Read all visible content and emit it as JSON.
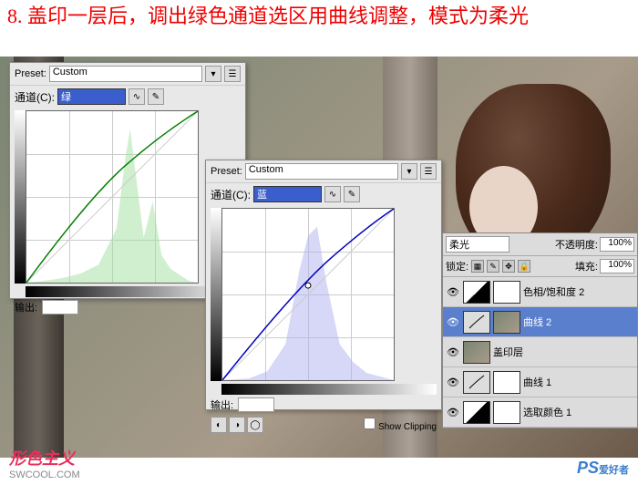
{
  "instruction": "8. 盖印一层后，调出绿色通道选区用曲线调整，模式为柔光",
  "curves1": {
    "preset_label": "Preset:",
    "preset_value": "Custom",
    "channel_label": "通道(C):",
    "channel_value": "绿",
    "output_label": "输出:",
    "histo_color": "#a0e0a0",
    "curve_color": "#008000"
  },
  "curves2": {
    "preset_label": "Preset:",
    "preset_value": "Custom",
    "channel_label": "通道(C):",
    "channel_value": "蓝",
    "output_label": "输出:",
    "show_clipping": "Show Clipping",
    "histo_color": "#b0b0f0",
    "curve_color": "#0000c0"
  },
  "layers": {
    "blend_mode": "柔光",
    "opacity_label": "不透明度:",
    "opacity_value": "100%",
    "lock_label": "锁定:",
    "fill_label": "填充:",
    "fill_value": "100%",
    "items": [
      {
        "name": "色相/饱和度 2",
        "type": "adj"
      },
      {
        "name": "曲线 2",
        "type": "curve",
        "selected": true
      },
      {
        "name": "盖印层",
        "type": "img"
      },
      {
        "name": "曲线 1",
        "type": "curve"
      },
      {
        "name": "选取颜色 1",
        "type": "adj"
      }
    ]
  },
  "watermark1_a": "形色主义",
  "watermark1_b": "SWCOOL.COM",
  "watermark2_a": "PS",
  "watermark2_b": "爱好者"
}
